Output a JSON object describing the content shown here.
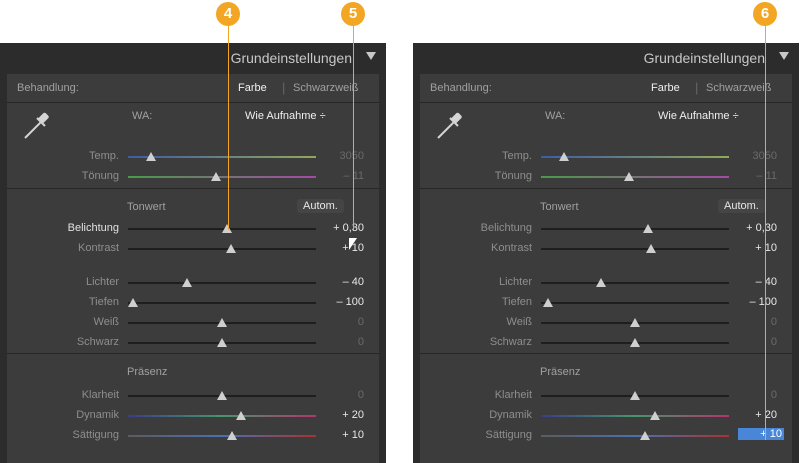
{
  "panel_title": "Grundeinstellungen",
  "behandlung": {
    "label": "Behandlung:",
    "farbe": "Farbe",
    "schwarzweiss": "Schwarzweiß"
  },
  "wa": {
    "label": "WA:",
    "value": "Wie Aufnahme ÷"
  },
  "sliders": {
    "temp": {
      "label": "Temp.",
      "value": "3050",
      "position": 0.12
    },
    "toenung": {
      "label": "Tönung",
      "value": "– 11",
      "position": 0.47
    },
    "belichtung": {
      "label": "Belichtung",
      "value": "+ 0,30",
      "position": 0.56
    },
    "kontrast": {
      "label": "Kontrast",
      "value": "+ 10",
      "position": 0.56
    },
    "lichter": {
      "label": "Lichter",
      "value": "– 40",
      "position": 0.29
    },
    "tiefen": {
      "label": "Tiefen",
      "value": "– 100",
      "position": 0.0
    },
    "weiss": {
      "label": "Weiß",
      "value": "0",
      "position": 0.5
    },
    "schwarz": {
      "label": "Schwarz",
      "value": "0",
      "position": 0.5
    },
    "klarheit": {
      "label": "Klarheit",
      "value": "0",
      "position": 0.5
    },
    "dynamik": {
      "label": "Dynamik",
      "value": "+ 20",
      "position": 0.6
    },
    "saettigung": {
      "label": "Sättigung",
      "value": "+ 10",
      "position": 0.55
    }
  },
  "tonwert": {
    "label": "Tonwert",
    "auto_label": "Autom."
  },
  "praesenz": {
    "label": "Präsenz"
  },
  "callouts": [
    "4",
    "5",
    "6"
  ],
  "colors": {
    "callout": "#f3a623",
    "panel_bg": "#3c3c3c",
    "selection": "#4a86d8"
  }
}
